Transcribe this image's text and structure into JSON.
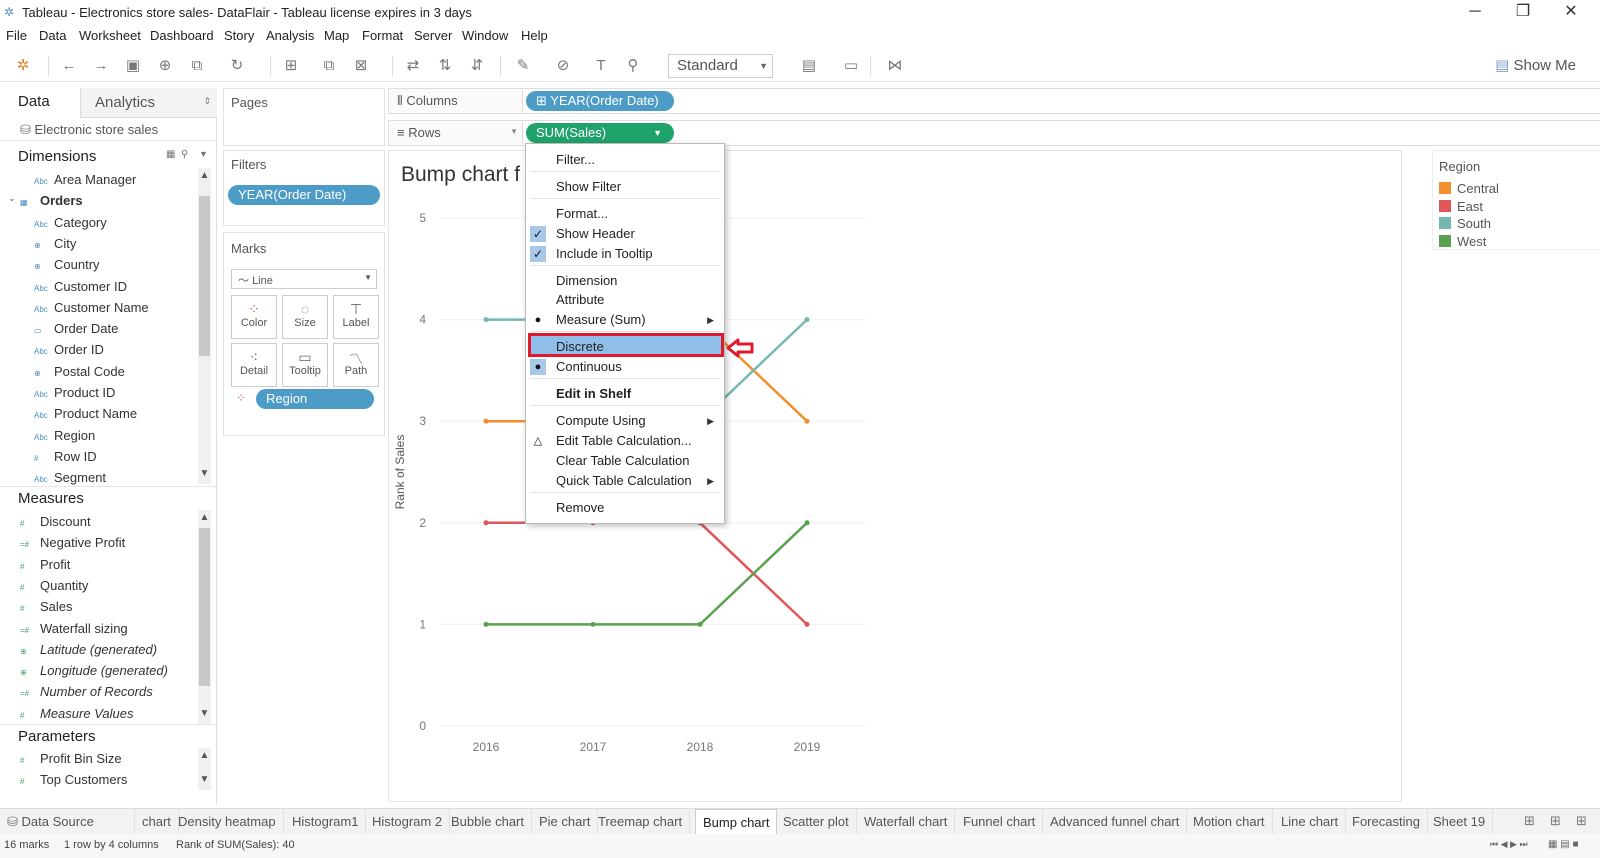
{
  "window": {
    "title": "Tableau - Electronics store sales- DataFlair - Tableau license expires in 3 days",
    "minimize": "─",
    "restore": "❐",
    "close": "✕"
  },
  "menu": [
    "File",
    "Data",
    "Worksheet",
    "Dashboard",
    "Story",
    "Analysis",
    "Map",
    "Format",
    "Server",
    "Window",
    "Help"
  ],
  "toolbar": {
    "fit_select": "Standard",
    "show_me": "Show Me"
  },
  "left_panel": {
    "tab_data": "Data",
    "tab_analytics": "Analytics",
    "data_source": "Electronic store sales",
    "dimensions_header": "Dimensions",
    "dimensions": [
      {
        "icon": "Abc",
        "label": "Area Manager"
      },
      {
        "icon": "▦",
        "label": "Orders",
        "bold": true
      },
      {
        "icon": "Abc",
        "label": "Category"
      },
      {
        "icon": "⊕",
        "label": "City"
      },
      {
        "icon": "⊕",
        "label": "Country"
      },
      {
        "icon": "Abc",
        "label": "Customer ID"
      },
      {
        "icon": "Abc",
        "label": "Customer Name"
      },
      {
        "icon": "▭",
        "label": "Order Date"
      },
      {
        "icon": "Abc",
        "label": "Order ID"
      },
      {
        "icon": "⊕",
        "label": "Postal Code"
      },
      {
        "icon": "Abc",
        "label": "Product ID"
      },
      {
        "icon": "Abc",
        "label": "Product Name"
      },
      {
        "icon": "Abc",
        "label": "Region"
      },
      {
        "icon": "#",
        "label": "Row ID"
      },
      {
        "icon": "Abc",
        "label": "Segment"
      }
    ],
    "measures_header": "Measures",
    "measures": [
      {
        "icon": "#",
        "label": "Discount",
        "italic": false
      },
      {
        "icon": "=#",
        "label": "Negative Profit",
        "italic": false
      },
      {
        "icon": "#",
        "label": "Profit",
        "italic": false
      },
      {
        "icon": "#",
        "label": "Quantity",
        "italic": false
      },
      {
        "icon": "#",
        "label": "Sales",
        "italic": false
      },
      {
        "icon": "=#",
        "label": "Waterfall sizing",
        "italic": false
      },
      {
        "icon": "⊕",
        "label": "Latitude (generated)",
        "italic": true
      },
      {
        "icon": "⊕",
        "label": "Longitude (generated)",
        "italic": true
      },
      {
        "icon": "=#",
        "label": "Number of Records",
        "italic": true
      },
      {
        "icon": "#",
        "label": "Measure Values",
        "italic": true
      }
    ],
    "parameters_header": "Parameters",
    "parameters": [
      {
        "icon": "#",
        "label": "Profit Bin Size"
      },
      {
        "icon": "#",
        "label": "Top Customers"
      }
    ]
  },
  "shelves": {
    "pages_label": "Pages",
    "filters_label": "Filters",
    "filter_pill": "YEAR(Order Date)",
    "marks_label": "Marks",
    "marks_type": "Line",
    "mark_buttons": [
      "Color",
      "Size",
      "Label",
      "Detail",
      "Tooltip",
      "Path"
    ],
    "color_pill": "Region",
    "columns_label": "Columns",
    "columns_pill": "⊞ YEAR(Order Date)",
    "rows_label": "Rows",
    "rows_pill": "SUM(Sales)"
  },
  "view": {
    "title": "Bump chart f"
  },
  "chart_data": {
    "type": "line",
    "x": [
      "2016",
      "2017",
      "2018",
      "2019"
    ],
    "ylabel": "Rank of Sales",
    "ylim": [
      0,
      5
    ],
    "yticks": [
      "0",
      "1",
      "2",
      "3",
      "4",
      "5"
    ],
    "series": [
      {
        "name": "Central",
        "color": "#f28e2b",
        "values": [
          3,
          3,
          4,
          3
        ]
      },
      {
        "name": "East",
        "color": "#e15759",
        "values": [
          2,
          2,
          2,
          1
        ]
      },
      {
        "name": "South",
        "color": "#76b7b2",
        "values": [
          4,
          4,
          3,
          4
        ]
      },
      {
        "name": "West",
        "color": "#59a14f",
        "values": [
          1,
          1,
          1,
          2
        ]
      }
    ]
  },
  "legend": {
    "title": "Region",
    "items": [
      {
        "label": "Central",
        "color": "#f28e2b"
      },
      {
        "label": "East",
        "color": "#e15759"
      },
      {
        "label": "South",
        "color": "#76b7b2"
      },
      {
        "label": "West",
        "color": "#59a14f"
      }
    ]
  },
  "context_menu": {
    "items": [
      {
        "label": "Filter...",
        "mark": "",
        "bold": false,
        "submenu": false
      },
      {
        "label": "Show Filter",
        "mark": "",
        "bold": false,
        "submenu": false
      },
      {
        "label": "Format...",
        "mark": "",
        "bold": false,
        "submenu": false
      },
      {
        "label": "Show Header",
        "mark": "check",
        "bold": false,
        "submenu": false
      },
      {
        "label": "Include in Tooltip",
        "mark": "check",
        "bold": false,
        "submenu": false
      },
      {
        "label": "Dimension",
        "mark": "",
        "bold": false,
        "submenu": false
      },
      {
        "label": "Attribute",
        "mark": "",
        "bold": false,
        "submenu": false
      },
      {
        "label": "Measure (Sum)",
        "mark": "bullet",
        "bold": false,
        "submenu": true
      },
      {
        "label": "Discrete",
        "mark": "",
        "bold": false,
        "submenu": false,
        "highlighted": true
      },
      {
        "label": "Continuous",
        "mark": "bullet",
        "bold": false,
        "submenu": false
      },
      {
        "label": "Edit in Shelf",
        "mark": "",
        "bold": true,
        "submenu": false
      },
      {
        "label": "Compute Using",
        "mark": "",
        "bold": false,
        "submenu": true
      },
      {
        "label": "Edit Table Calculation...",
        "mark": "delta",
        "bold": false,
        "submenu": false
      },
      {
        "label": "Clear Table Calculation",
        "mark": "",
        "bold": false,
        "submenu": false
      },
      {
        "label": "Quick Table Calculation",
        "mark": "",
        "bold": false,
        "submenu": true
      },
      {
        "label": "Remove",
        "mark": "",
        "bold": false,
        "submenu": false
      }
    ]
  },
  "sheet_tabs": {
    "data_source": "Data Source",
    "tabs": [
      "chart",
      "Density heatmap",
      "Histogram1",
      "Histogram 2",
      "Bubble chart",
      "Pie chart",
      "Treemap chart",
      "Bump chart",
      "Scatter plot",
      "Waterfall chart",
      "Funnel chart",
      "Advanced funnel chart",
      "Motion chart",
      "Line chart",
      "Forecasting",
      "Sheet 19"
    ],
    "active": "Bump chart"
  },
  "status": {
    "marks": "16 marks",
    "dims": "1 row by 4 columns",
    "summary": "Rank of SUM(Sales): 40"
  }
}
